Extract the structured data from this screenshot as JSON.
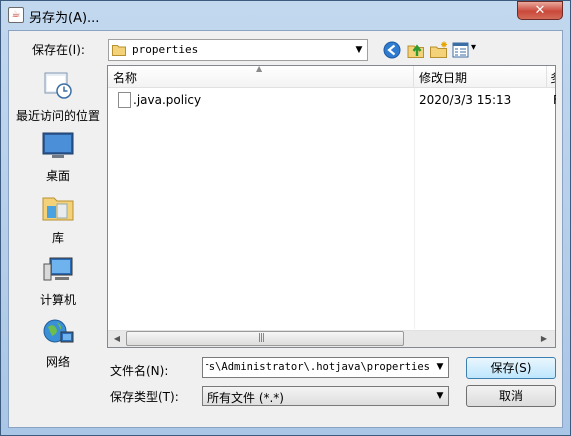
{
  "window": {
    "title": "另存为(A)...",
    "close_label": "✕"
  },
  "toolbar": {
    "save_in_label": "保存在(I):",
    "location": "properties",
    "view_menu_arrow": "▾"
  },
  "places": [
    {
      "label": "最近访问的位置",
      "icon": "recent-places-icon"
    },
    {
      "label": "桌面",
      "icon": "desktop-icon"
    },
    {
      "label": "库",
      "icon": "libraries-icon"
    },
    {
      "label": "计算机",
      "icon": "computer-icon"
    },
    {
      "label": "网络",
      "icon": "network-icon"
    }
  ],
  "list": {
    "columns": [
      "名称",
      "修改日期",
      "多"
    ],
    "rows": [
      {
        "name": ".java.policy",
        "date": "2020/3/3 15:13",
        "extra": "F"
      }
    ]
  },
  "scroll": {
    "grip": "|||"
  },
  "form": {
    "filename_label": "文件名(N):",
    "filename_value": "C:\\Users\\Administrator\\.hotjava\\properties",
    "filetype_label": "保存类型(T):",
    "filetype_value": "所有文件 (*.*)"
  },
  "buttons": {
    "save": "保存(S)",
    "cancel": "取消"
  },
  "colors": {
    "frame": "#c2d8ef",
    "close": "#c9483a",
    "primary_button": "#bee6fd"
  }
}
